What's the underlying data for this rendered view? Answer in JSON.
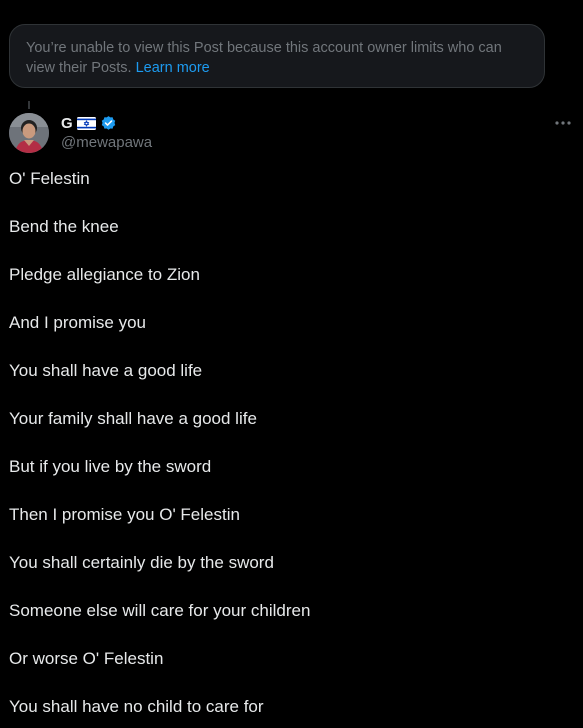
{
  "notice": {
    "text": "You’re unable to view this Post because this account owner limits who can view their Posts.",
    "link": "Learn more"
  },
  "post": {
    "display_name": "G",
    "handle": "@mewapawa",
    "flag_icon": "israel-flag",
    "verified_color": "#1d9bf0",
    "lines": [
      "O' Felestin",
      "Bend the knee",
      "Pledge allegiance to Zion",
      "And I promise you",
      "You shall have a good life",
      "Your family shall have a good life",
      "But if you live by the sword",
      "Then I promise you O' Felestin",
      "You shall certainly die by the sword",
      "Someone else will care for your children",
      "Or worse O' Felestin",
      "You shall have no child to care for"
    ]
  },
  "colors": {
    "background": "#000000",
    "text": "#e7e9ea",
    "muted": "#71767b",
    "accent": "#1d9bf0",
    "notice_bg": "#16181c"
  }
}
